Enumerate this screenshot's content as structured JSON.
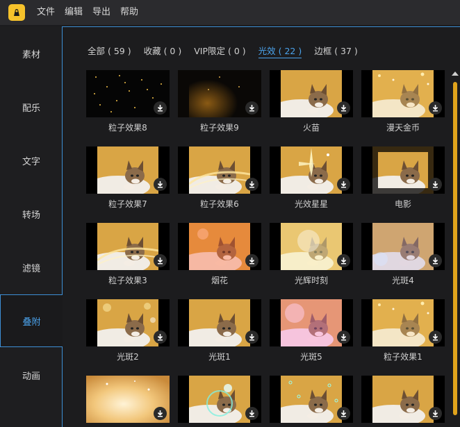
{
  "menu": {
    "items": [
      "文件",
      "编辑",
      "导出",
      "帮助"
    ]
  },
  "sidebar": {
    "items": [
      {
        "label": "素材",
        "active": false
      },
      {
        "label": "配乐",
        "active": false
      },
      {
        "label": "文字",
        "active": false
      },
      {
        "label": "转场",
        "active": false
      },
      {
        "label": "滤镜",
        "active": false
      },
      {
        "label": "叠附",
        "active": true
      },
      {
        "label": "动画",
        "active": false
      }
    ]
  },
  "tabs": [
    {
      "label": "全部 ( 59 )",
      "active": false
    },
    {
      "label": "收藏 ( 0 )",
      "active": false
    },
    {
      "label": "VIP限定 ( 0 )",
      "active": false
    },
    {
      "label": "光效 ( 22 )",
      "active": true
    },
    {
      "label": "边框 ( 37 )",
      "active": false
    }
  ],
  "effects": [
    {
      "name": "粒子效果8",
      "style": "dark-particles"
    },
    {
      "name": "粒子效果9",
      "style": "dark-glow"
    },
    {
      "name": "火苗",
      "style": "cat"
    },
    {
      "name": "漫天金币",
      "style": "cat-gold"
    },
    {
      "name": "粒子效果7",
      "style": "cat"
    },
    {
      "name": "粒子效果6",
      "style": "cat-swirl"
    },
    {
      "name": "光效星星",
      "style": "cat-star"
    },
    {
      "name": "电影",
      "style": "cat-vignette"
    },
    {
      "name": "粒子效果3",
      "style": "cat-swirl"
    },
    {
      "name": "烟花",
      "style": "cat-red"
    },
    {
      "name": "光辉时刻",
      "style": "cat-bright"
    },
    {
      "name": "光斑4",
      "style": "cat-blur"
    },
    {
      "name": "光斑2",
      "style": "cat-bokeh"
    },
    {
      "name": "光斑1",
      "style": "cat"
    },
    {
      "name": "光斑5",
      "style": "cat-pink"
    },
    {
      "name": "粒子效果1",
      "style": "cat-gold"
    },
    {
      "name": "",
      "style": "glare"
    },
    {
      "name": "",
      "style": "cat-ring"
    },
    {
      "name": "",
      "style": "cat-drops"
    },
    {
      "name": "",
      "style": "cat"
    }
  ],
  "colors": {
    "accent": "#4ba3ec",
    "scrollbar": "#e0a31c",
    "logo": "#f6c22b"
  }
}
